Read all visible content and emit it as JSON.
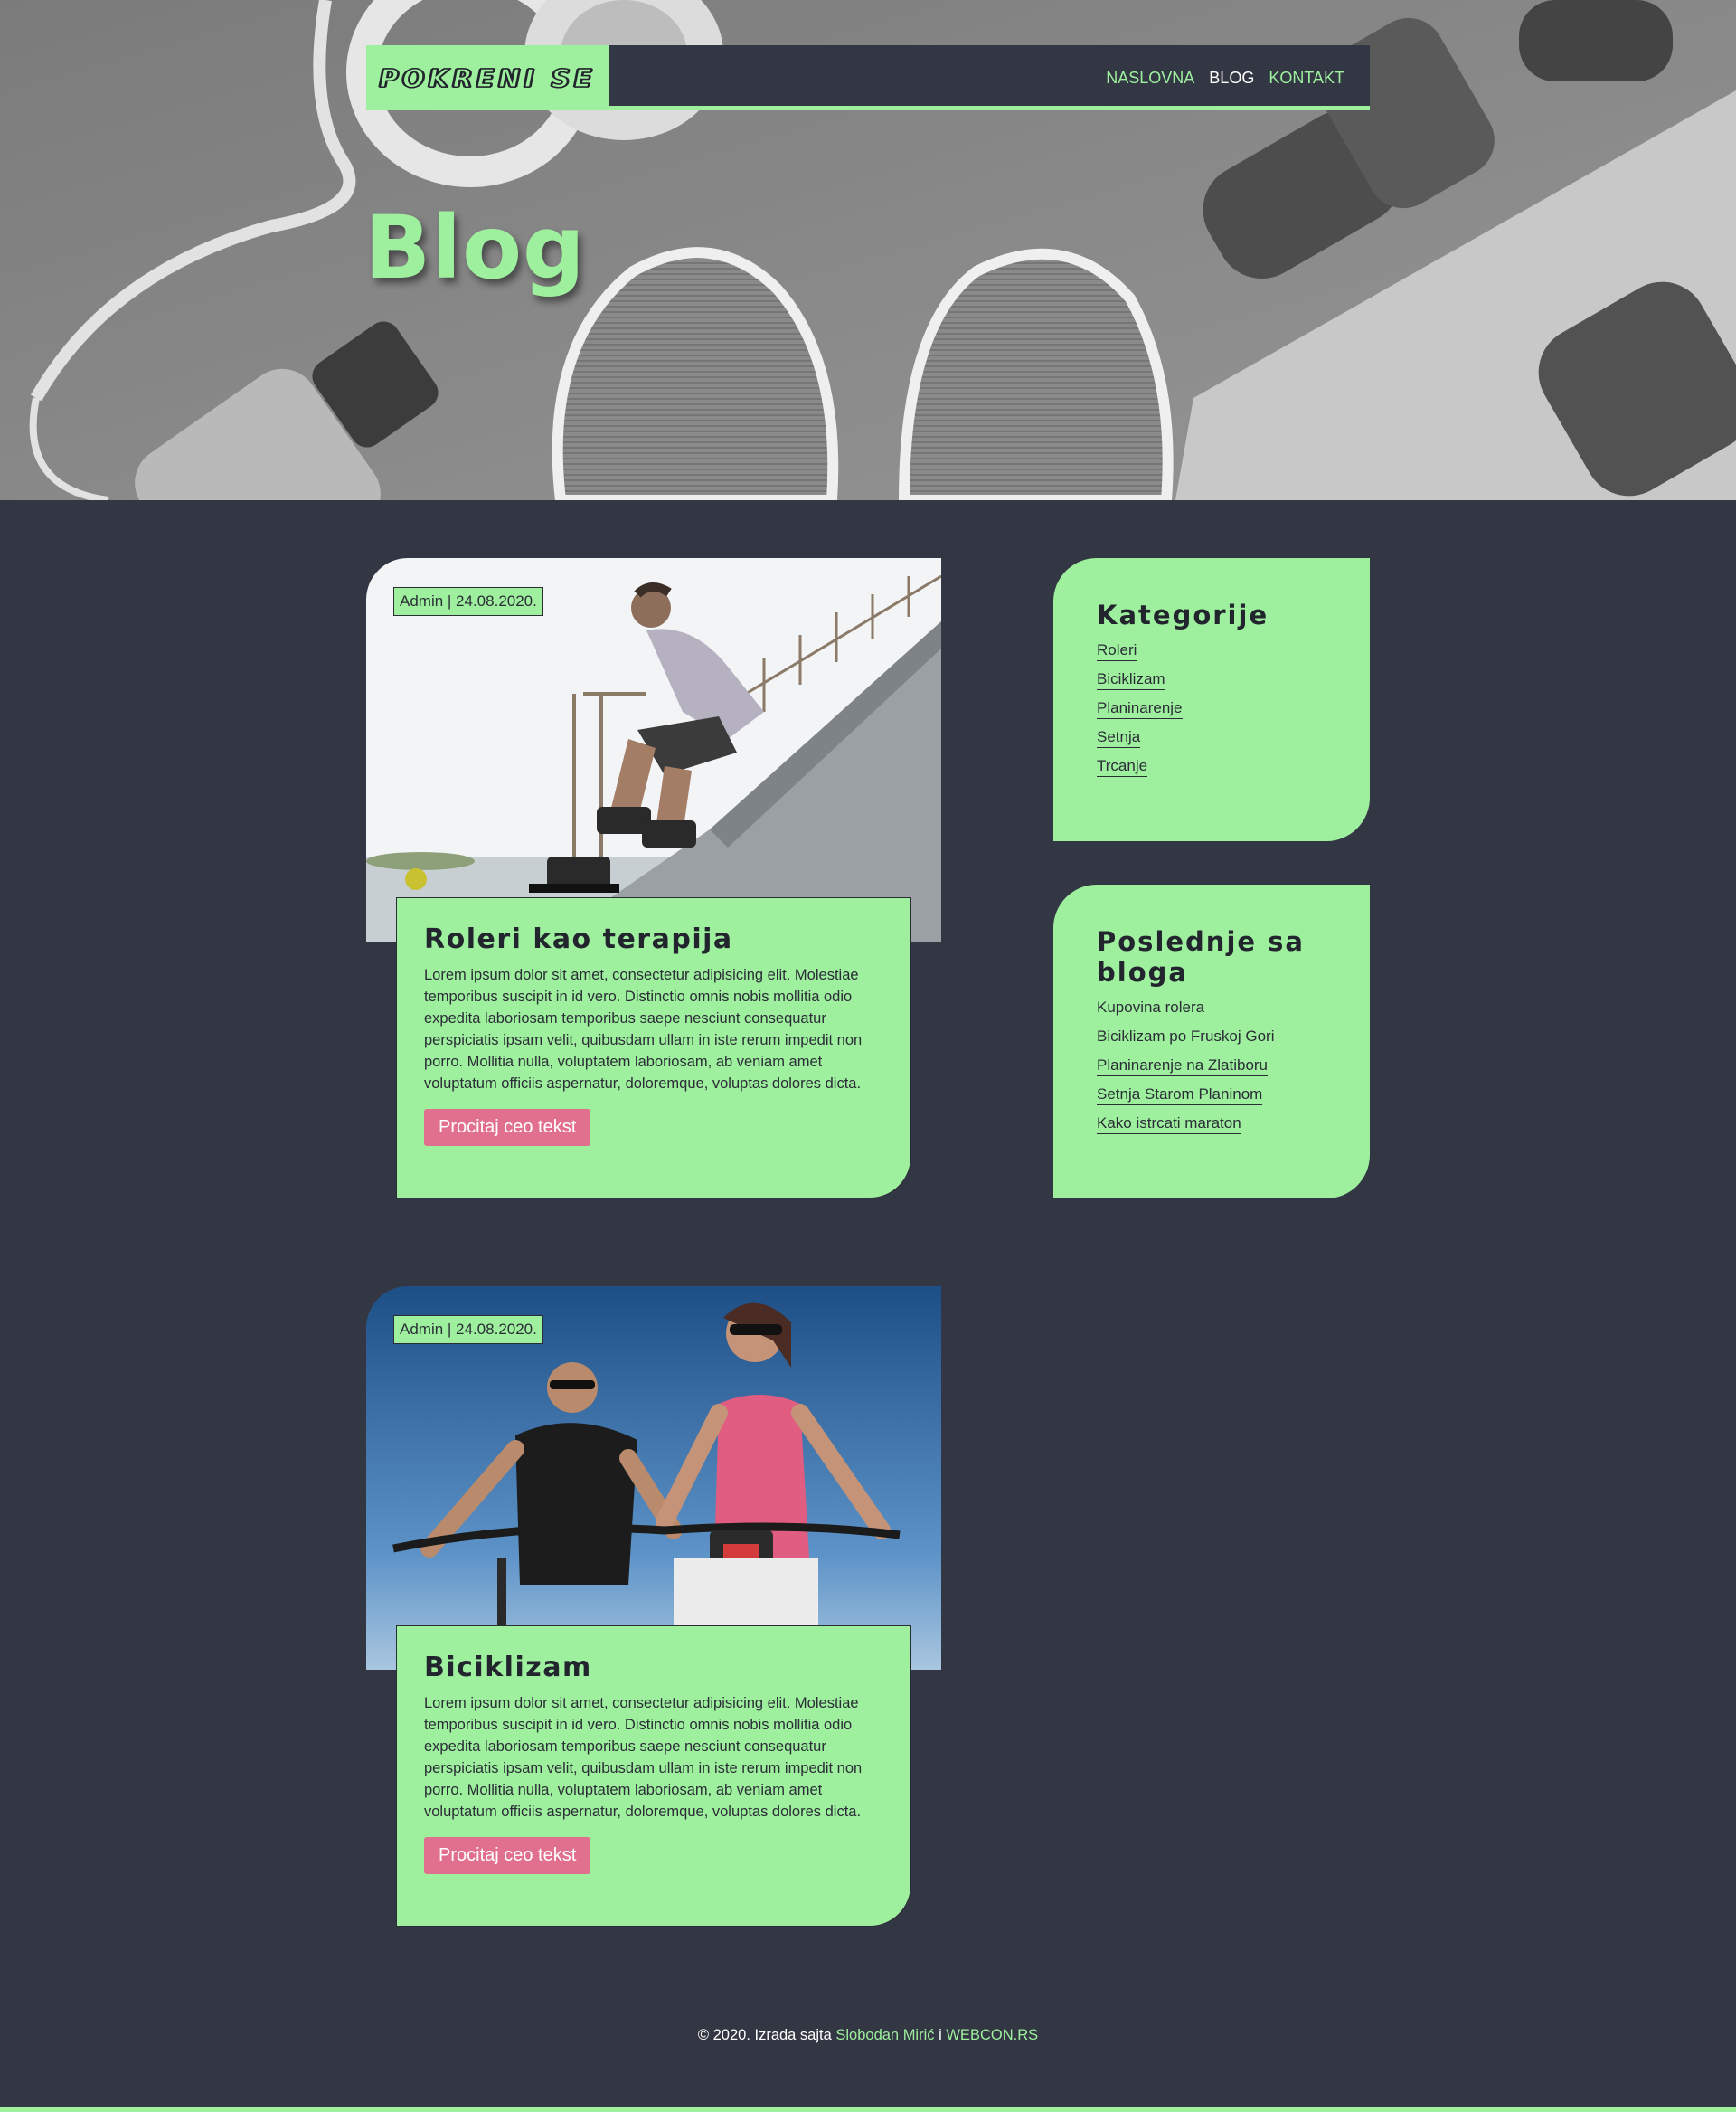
{
  "brand": {
    "logo_text": "POKRENI SE"
  },
  "nav": {
    "items": [
      {
        "label": "NASLOVNA",
        "active": false
      },
      {
        "label": "BLOG",
        "active": true
      },
      {
        "label": "KONTAKT",
        "active": false
      }
    ]
  },
  "hero": {
    "title": "Blog"
  },
  "posts": [
    {
      "meta": "Admin | 24.08.2020.",
      "title": "Roleri kao terapija",
      "excerpt": "Lorem ipsum dolor sit amet, consectetur adipisicing elit. Molestiae temporibus suscipit in id vero. Distinctio omnis nobis mollitia odio expedita laboriosam temporibus saepe nesciunt consequatur perspiciatis ipsam velit, quibusdam ullam in iste rerum impedit non porro. Mollitia nulla, voluptatem laboriosam, ab veniam amet voluptatum officiis aspernatur, doloremque, voluptas dolores dicta.",
      "button": "Procitaj ceo tekst"
    },
    {
      "meta": "Admin | 24.08.2020.",
      "title": "Biciklizam",
      "excerpt": "Lorem ipsum dolor sit amet, consectetur adipisicing elit. Molestiae temporibus suscipit in id vero. Distinctio omnis nobis mollitia odio expedita laboriosam temporibus saepe nesciunt consequatur perspiciatis ipsam velit, quibusdam ullam in iste rerum impedit non porro. Mollitia nulla, voluptatem laboriosam, ab veniam amet voluptatum officiis aspernatur, doloremque, voluptas dolores dicta.",
      "button": "Procitaj ceo tekst"
    }
  ],
  "sidebar": {
    "categories": {
      "title": "Kategorije",
      "items": [
        "Roleri",
        "Biciklizam",
        "Planinarenje",
        "Setnja",
        "Trcanje"
      ]
    },
    "recent": {
      "title": "Poslednje sa bloga",
      "items": [
        "Kupovina rolera",
        "Biciklizam po Fruskoj Gori",
        "Planinarenje na Zlatiboru",
        "Setnja Starom Planinom",
        "Kako istrcati maraton"
      ]
    }
  },
  "footer": {
    "prefix": "© 2020. Izrada sajta ",
    "author": "Slobodan Mirić",
    "separator": " i ",
    "company": "WEBCON.RS"
  },
  "colors": {
    "accent": "#9ef09e",
    "background": "#333743",
    "button": "#e0708e"
  }
}
